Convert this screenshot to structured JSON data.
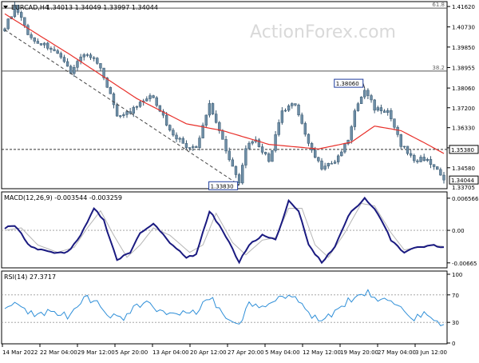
{
  "header": {
    "symbol": "EURCAD,H4",
    "ohlc": "1.34013 1.34049 1.33997 1.34044"
  },
  "watermark": "ActionForex.com",
  "chart_data": [
    {
      "type": "candlestick",
      "name": "price",
      "ylim": [
        1.337,
        1.418
      ],
      "y_ticks": [
        1.4162,
        1.4073,
        1.3985,
        1.38955,
        1.3806,
        1.372,
        1.3633,
        1.3545,
        1.3458
      ],
      "y_tick_labels": [
        "1.41620",
        "1.40730",
        "1.39850",
        "1.38955",
        "1.38060",
        "1.37200",
        "1.36330",
        "1.35450",
        "1.34580"
      ],
      "bottom_label": "1.33705",
      "x_labels": [
        "14 Mar 2022",
        "22 Mar 04:00",
        "29 Mar 12:00",
        "5 Apr 20:00",
        "13 Apr 04:00",
        "20 Apr 12:00",
        "27 Apr 20:00",
        "5 May 04:00",
        "12 May 12:00",
        "19 May 20:00",
        "27 May 04:00",
        "3 Jun 12:00"
      ],
      "fib_levels": [
        {
          "label": "61.8",
          "value": 1.4155
        },
        {
          "label": "38.2",
          "value": 1.388
        }
      ],
      "horizontal_lines": [
        {
          "value": 1.3538,
          "label": "1.35380",
          "style": "dashed"
        }
      ],
      "price_marker": {
        "value": 1.34044,
        "label": "1.34044"
      },
      "trendline": [
        [
          0,
          1.406
        ],
        [
          71,
          1.3383
        ]
      ],
      "annotations": [
        {
          "label": "1.33830",
          "index": 71,
          "value": 1.3383
        },
        {
          "label": "1.38060",
          "index": 109,
          "value": 1.3806
        }
      ],
      "close_anchors": [
        [
          0,
          1.4065
        ],
        [
          3,
          1.416
        ],
        [
          8,
          1.402
        ],
        [
          14,
          1.398
        ],
        [
          20,
          1.388
        ],
        [
          24,
          1.396
        ],
        [
          27,
          1.393
        ],
        [
          30,
          1.386
        ],
        [
          34,
          1.369
        ],
        [
          38,
          1.37
        ],
        [
          42,
          1.375
        ],
        [
          45,
          1.377
        ],
        [
          50,
          1.362
        ],
        [
          55,
          1.355
        ],
        [
          58,
          1.354
        ],
        [
          62,
          1.374
        ],
        [
          66,
          1.358
        ],
        [
          71,
          1.3383
        ],
        [
          73,
          1.355
        ],
        [
          76,
          1.357
        ],
        [
          80,
          1.349
        ],
        [
          84,
          1.37
        ],
        [
          88,
          1.374
        ],
        [
          92,
          1.356
        ],
        [
          96,
          1.346
        ],
        [
          100,
          1.348
        ],
        [
          104,
          1.358
        ],
        [
          106,
          1.37
        ],
        [
          109,
          1.38
        ],
        [
          112,
          1.372
        ],
        [
          116,
          1.37
        ],
        [
          120,
          1.356
        ],
        [
          124,
          1.349
        ],
        [
          128,
          1.35
        ],
        [
          131,
          1.344
        ],
        [
          133,
          1.3404
        ]
      ],
      "ma_anchors": [
        [
          0,
          1.413
        ],
        [
          20,
          1.395
        ],
        [
          40,
          1.376
        ],
        [
          55,
          1.365
        ],
        [
          66,
          1.362
        ],
        [
          80,
          1.356
        ],
        [
          95,
          1.354
        ],
        [
          105,
          1.357
        ],
        [
          112,
          1.364
        ],
        [
          120,
          1.362
        ],
        [
          128,
          1.356
        ],
        [
          133,
          1.352
        ]
      ]
    },
    {
      "type": "line",
      "name": "macd",
      "label": "MACD(12,26,9) -0.003544 -0.003259",
      "ylim": [
        -0.0075,
        0.0072
      ],
      "y_ticks": [
        0.006566,
        0.0,
        -0.00665
      ],
      "y_tick_labels": [
        "0.006566",
        "0.00",
        "-0.00665"
      ],
      "main_anchors": [
        [
          0,
          0.0005
        ],
        [
          3,
          0.001
        ],
        [
          8,
          -0.0035
        ],
        [
          14,
          -0.0045
        ],
        [
          19,
          -0.0045
        ],
        [
          23,
          -0.001
        ],
        [
          27,
          0.0045
        ],
        [
          30,
          0.002
        ],
        [
          34,
          -0.006
        ],
        [
          38,
          -0.0045
        ],
        [
          41,
          -0.0005
        ],
        [
          45,
          0.0015
        ],
        [
          50,
          -0.0025
        ],
        [
          55,
          -0.0055
        ],
        [
          58,
          -0.005
        ],
        [
          62,
          0.004
        ],
        [
          66,
          0.0
        ],
        [
          71,
          -0.0065
        ],
        [
          74,
          -0.003
        ],
        [
          78,
          -0.001
        ],
        [
          82,
          -0.002
        ],
        [
          86,
          0.006
        ],
        [
          89,
          0.004
        ],
        [
          92,
          -0.003
        ],
        [
          96,
          -0.0065
        ],
        [
          100,
          -0.0035
        ],
        [
          104,
          0.003
        ],
        [
          109,
          0.0065
        ],
        [
          113,
          0.0035
        ],
        [
          117,
          -0.002
        ],
        [
          121,
          -0.0045
        ],
        [
          125,
          -0.0035
        ],
        [
          129,
          -0.003
        ],
        [
          133,
          -0.0035
        ]
      ],
      "signal_anchors": [
        [
          0,
          0.0
        ],
        [
          5,
          0.0005
        ],
        [
          10,
          -0.003
        ],
        [
          16,
          -0.0045
        ],
        [
          21,
          -0.0035
        ],
        [
          25,
          0.0005
        ],
        [
          29,
          0.004
        ],
        [
          33,
          -0.001
        ],
        [
          37,
          -0.0055
        ],
        [
          41,
          -0.003
        ],
        [
          45,
          0.0005
        ],
        [
          50,
          -0.001
        ],
        [
          56,
          -0.0045
        ],
        [
          60,
          -0.003
        ],
        [
          64,
          0.0035
        ],
        [
          69,
          -0.0025
        ],
        [
          73,
          -0.005
        ],
        [
          78,
          -0.002
        ],
        [
          82,
          -0.0015
        ],
        [
          86,
          0.0045
        ],
        [
          90,
          0.0045
        ],
        [
          94,
          -0.003
        ],
        [
          98,
          -0.0055
        ],
        [
          103,
          -0.0005
        ],
        [
          108,
          0.0055
        ],
        [
          112,
          0.005
        ],
        [
          117,
          -0.0005
        ],
        [
          121,
          -0.004
        ],
        [
          125,
          -0.0035
        ],
        [
          129,
          -0.003
        ],
        [
          133,
          -0.0033
        ]
      ]
    },
    {
      "type": "line",
      "name": "rsi",
      "label": "RSI(14) 27.3717",
      "ylim": [
        0,
        100
      ],
      "y_ticks": [
        100,
        70,
        30,
        0
      ],
      "y_tick_labels": [
        "100",
        "70",
        "30",
        "0"
      ],
      "anchors": [
        [
          0,
          48
        ],
        [
          3,
          62
        ],
        [
          8,
          42
        ],
        [
          14,
          45
        ],
        [
          20,
          38
        ],
        [
          24,
          68
        ],
        [
          28,
          58
        ],
        [
          32,
          40
        ],
        [
          36,
          33
        ],
        [
          40,
          55
        ],
        [
          44,
          58
        ],
        [
          48,
          43
        ],
        [
          54,
          42
        ],
        [
          58,
          45
        ],
        [
          62,
          68
        ],
        [
          66,
          43
        ],
        [
          71,
          28
        ],
        [
          74,
          55
        ],
        [
          78,
          52
        ],
        [
          84,
          70
        ],
        [
          88,
          68
        ],
        [
          92,
          42
        ],
        [
          96,
          35
        ],
        [
          100,
          43
        ],
        [
          104,
          62
        ],
        [
          107,
          68
        ],
        [
          110,
          74
        ],
        [
          113,
          60
        ],
        [
          117,
          65
        ],
        [
          121,
          44
        ],
        [
          124,
          36
        ],
        [
          127,
          41
        ],
        [
          130,
          30
        ],
        [
          133,
          27
        ]
      ]
    }
  ]
}
